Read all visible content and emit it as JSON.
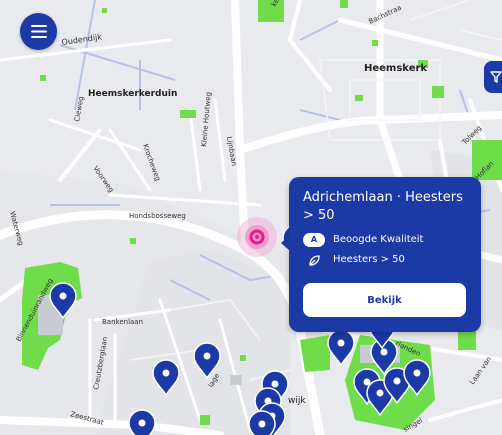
{
  "map": {
    "labels": {
      "oudendijk": "Oudendijk",
      "heemskerk": "Heemskerk",
      "heemskerkerduin": "Heemskerkerduin",
      "cieweg": "Cieweg",
      "voorweg": "Voorweg",
      "krocheweg": "Krocheweg",
      "kleine_houtweg": "Kleine Houtweg",
      "lijnbaan": "Lijnbaan",
      "hondsbosseweg": "Hondsbosseweg",
      "waterweg": "Waterweg",
      "binnenduinrandweg": "Binnenduinrandweg",
      "bankenlaan": "Bankenlaan",
      "creutzberglaan": "Creutzberglaan",
      "zeestraat": "Zeestraat",
      "bachstraat": "Bachstraa",
      "tolweg": "Tolweg",
      "rijnlanden": "rlanden",
      "laan": "Laan van",
      "kerk": "kerk",
      "wijk": "wijk",
      "lage": "lage",
      "singel": "singel",
      "hoflan": "Hoflan"
    }
  },
  "controls": {
    "menu_icon": "menu-icon",
    "filter_icon": "filter-icon"
  },
  "popup": {
    "title": "Adrichemlaan · Heesters > 50",
    "badge": "A",
    "quality_label": "Beoogde Kwaliteit",
    "type_label": "Heesters > 50",
    "button_label": "Bekijk"
  },
  "colors": {
    "accent": "#1c3aa6",
    "selected": "#e8198b",
    "green": "#6fdc4a"
  }
}
